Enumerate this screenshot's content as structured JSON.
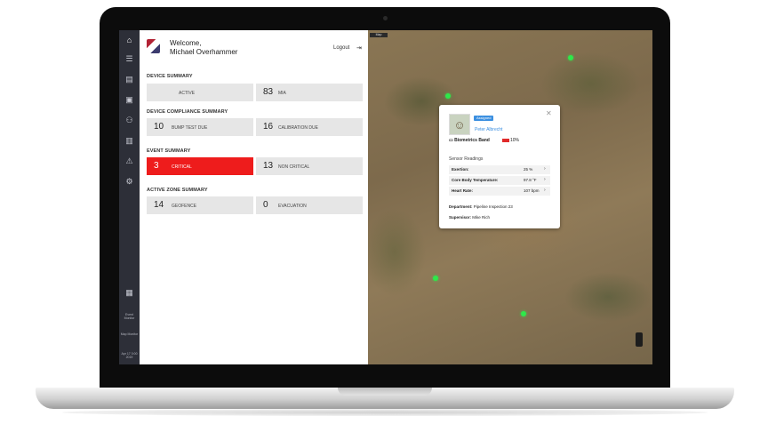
{
  "user": {
    "greeting": "Welcome,",
    "name": "Michael Overhammer"
  },
  "header": {
    "logout_label": "Logout"
  },
  "sidebar": {
    "icons": [
      "home-icon",
      "list-icon",
      "grid-icon",
      "clipboard-icon",
      "people-icon",
      "chart-icon",
      "alert-icon",
      "settings-icon"
    ],
    "footer_labels": [
      "Event Monitor",
      "Map Monitor"
    ],
    "version": "Apr 17 0:00 2019"
  },
  "device_summary": {
    "title": "DEVICE SUMMARY",
    "active": {
      "value": "",
      "label": "ACTIVE"
    },
    "mia": {
      "value": "83",
      "label": "MIA"
    }
  },
  "compliance_summary": {
    "title": "DEVICE COMPLIANCE  SUMMARY",
    "bump": {
      "value": "10",
      "label": "BUMP TEST DUE"
    },
    "calibration": {
      "value": "16",
      "label": "CALIBRATION DUE"
    }
  },
  "event_summary": {
    "title": "EVENT SUMMARY",
    "critical": {
      "value": "3",
      "label": "CRITICAL"
    },
    "non_critical": {
      "value": "13",
      "label": "NON CRITICAL"
    }
  },
  "zone_summary": {
    "title": "ACTIVE ZONE  SUMMARY",
    "geofence": {
      "value": "14",
      "label": "GEOFENCE"
    },
    "evacuation": {
      "value": "0",
      "label": "EVACUATION"
    }
  },
  "map": {
    "tab_label": "Map"
  },
  "popup": {
    "status_tag": "Assigned",
    "person_name": "Peter Albrecht",
    "device": "Biometrics Band",
    "battery": "10%",
    "section_title": "Sensor Readings",
    "readings": [
      {
        "label": "Exertion:",
        "value": "25 %"
      },
      {
        "label": "Core Body Temperature:",
        "value": "97.8 °F"
      },
      {
        "label": "Heart Rate:",
        "value": "107 bpm"
      }
    ],
    "department_label": "Department:",
    "department_value": "Pipeline Inspection 23",
    "supervisor_label": "Supervisor:",
    "supervisor_value": "Mike Rich"
  },
  "colors": {
    "critical": "#ee1c1c",
    "link": "#3b8fe0",
    "marker": "#2ee84a",
    "sidebar": "#2d2f38"
  }
}
